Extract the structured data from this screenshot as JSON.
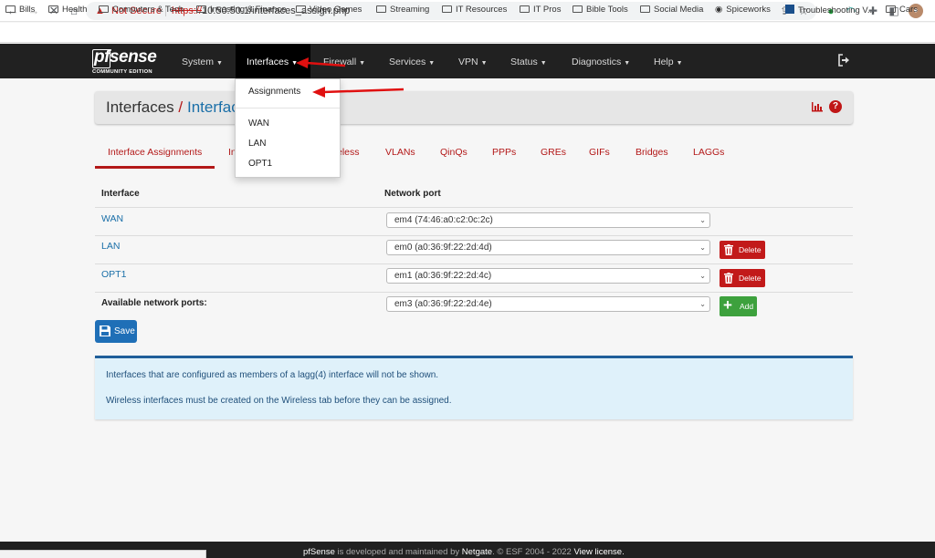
{
  "browser": {
    "security_label": "Not Secure",
    "url_scheme": "https://",
    "url_rest": "10.50.50.1/interfaces_assign.php",
    "bookmarks": [
      "Bills",
      "Health",
      "Computers & Tech",
      "Investing & Finance",
      "Video Games",
      "Streaming",
      "IT Resources",
      "IT Pros",
      "Bible Tools",
      "Social Media",
      "Spiceworks",
      "Troubleshooting V...",
      "Cars"
    ]
  },
  "brand": {
    "logo": "pfsense",
    "edition": "COMMUNITY EDITION"
  },
  "navbar": {
    "menus": [
      "System",
      "Interfaces",
      "Firewall",
      "Services",
      "VPN",
      "Status",
      "Diagnostics",
      "Help"
    ]
  },
  "dropdown": {
    "items": [
      "Assignments",
      "WAN",
      "LAN",
      "OPT1"
    ]
  },
  "breadcrumb": {
    "root": "Interfaces",
    "separator": "/",
    "current": "Interfac"
  },
  "tabs": [
    "Interface Assignments",
    "In",
    "eless",
    "VLANs",
    "QinQs",
    "PPPs",
    "GREs",
    "GIFs",
    "Bridges",
    "LAGGs"
  ],
  "table": {
    "headers": [
      "Interface",
      "Network port"
    ],
    "rows": [
      {
        "name": "WAN",
        "port": "em4 (74:46:a0:c2:0c:2c)"
      },
      {
        "name": "LAN",
        "port": "em0 (a0:36:9f:22:2d:4d)",
        "action": "Delete"
      },
      {
        "name": "OPT1",
        "port": "em1 (a0:36:9f:22:2d:4c)",
        "action": "Delete"
      }
    ],
    "available_label": "Available network ports:",
    "available_port": "em3 (a0:36:9f:22:2d:4e)",
    "add_label": "Add"
  },
  "save_label": "Save",
  "info": [
    "Interfaces that are configured as members of a lagg(4) interface will not be shown.",
    "Wireless interfaces must be created on the Wireless tab before they can be assigned."
  ],
  "footer": {
    "brand": "pfSense",
    "text1": " is developed and maintained by ",
    "company": "Netgate",
    "text2": ". © ESF 2004 - 2022 ",
    "link": "View license."
  },
  "colors": {
    "accent_red": "#b31818",
    "link_blue": "#1a6fa8",
    "navbar": "#212121",
    "info_bg": "#dff1fa",
    "add_green": "#3da13d",
    "save_blue": "#1f6fb7"
  }
}
